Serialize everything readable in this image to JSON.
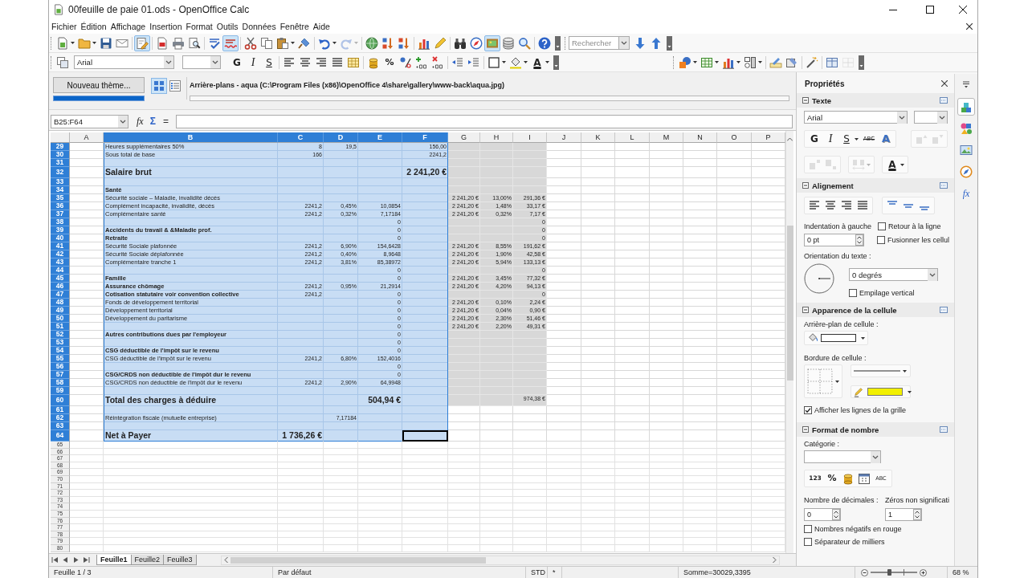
{
  "window": {
    "title": "00feuille de paie 01.ods - OpenOffice Calc"
  },
  "menu": [
    "Fichier",
    "Édition",
    "Affichage",
    "Insertion",
    "Format",
    "Outils",
    "Données",
    "Fenêtre",
    "Aide"
  ],
  "standard_toolbar": {
    "groups": [
      [
        {
          "kind": "document",
          "on": false,
          "disabled": false
        },
        {
          "kind": "caret",
          "on": false,
          "disabled": false
        },
        {
          "kind": "folder",
          "on": false,
          "disabled": false
        },
        {
          "kind": "caret",
          "on": false,
          "disabled": false
        },
        {
          "kind": "save",
          "on": false,
          "disabled": false
        },
        {
          "kind": "envelope",
          "on": false,
          "disabled": false
        }
      ],
      [
        {
          "kind": "edit",
          "on": true,
          "disabled": false
        }
      ],
      [
        {
          "kind": "pdf",
          "on": false,
          "disabled": false
        },
        {
          "kind": "printer",
          "on": false,
          "disabled": false
        },
        {
          "kind": "preview",
          "on": false,
          "disabled": false
        }
      ],
      [
        {
          "kind": "spellcheck",
          "on": false,
          "disabled": false
        },
        {
          "kind": "autospell",
          "on": true,
          "disabled": false
        }
      ],
      [
        {
          "kind": "scissors",
          "on": false,
          "disabled": false
        },
        {
          "kind": "copy",
          "on": false,
          "disabled": false
        },
        {
          "kind": "clipboard",
          "on": false,
          "disabled": false
        },
        {
          "kind": "caret",
          "on": false,
          "disabled": false
        },
        {
          "kind": "brush",
          "on": false,
          "disabled": false
        }
      ],
      [
        {
          "kind": "undo",
          "on": false,
          "disabled": false
        },
        {
          "kind": "caret",
          "on": false,
          "disabled": false
        },
        {
          "kind": "redo",
          "on": false,
          "disabled": true
        },
        {
          "kind": "caret",
          "on": false,
          "disabled": true
        }
      ],
      [
        {
          "kind": "globe",
          "on": false,
          "disabled": false
        },
        {
          "kind": "sort-asc",
          "on": false,
          "disabled": false
        },
        {
          "kind": "sort-desc",
          "on": false,
          "disabled": false
        }
      ],
      [
        {
          "kind": "chart",
          "on": false,
          "disabled": false
        },
        {
          "kind": "draw",
          "on": false,
          "disabled": false
        }
      ],
      [
        {
          "kind": "binoculars",
          "on": false,
          "disabled": false
        },
        {
          "kind": "compass",
          "on": false,
          "disabled": false
        },
        {
          "kind": "gallery",
          "on": true,
          "disabled": false
        },
        {
          "kind": "database",
          "on": false,
          "disabled": false
        },
        {
          "kind": "magnifier",
          "on": false,
          "disabled": false
        }
      ],
      [
        {
          "kind": "help",
          "on": false,
          "disabled": false
        }
      ]
    ]
  },
  "find_toolbar": {
    "placeholder": "Rechercher",
    "groups": [
      [
        {
          "kind": "arrow-down"
        },
        {
          "kind": "arrow-up"
        }
      ]
    ]
  },
  "formatting_toolbar": {
    "leading": [
      {
        "kind": "styles"
      }
    ],
    "font_name": "Arial",
    "groups": [
      [
        {
          "kind": "bold",
          "label": "G"
        },
        {
          "kind": "italic",
          "label": "I"
        },
        {
          "kind": "underline",
          "label": "S"
        }
      ],
      [
        {
          "kind": "align-left"
        },
        {
          "kind": "align-center"
        },
        {
          "kind": "align-right"
        },
        {
          "kind": "justify"
        },
        {
          "kind": "merge"
        }
      ],
      [
        {
          "kind": "coins"
        },
        {
          "kind": "percent",
          "label": "%"
        },
        {
          "kind": "number-format"
        },
        {
          "kind": "add-decimal"
        },
        {
          "kind": "del-decimal"
        }
      ],
      [
        {
          "kind": "indent-dec"
        },
        {
          "kind": "indent-inc"
        }
      ],
      [
        {
          "kind": "border"
        },
        {
          "kind": "caret"
        },
        {
          "kind": "bucket"
        },
        {
          "kind": "caret"
        },
        {
          "kind": "font-color",
          "label": "A"
        },
        {
          "kind": "caret"
        }
      ]
    ]
  },
  "drawing_toolbar": {
    "groups": [
      [
        {
          "kind": "shapes",
          "disabled": false
        },
        {
          "kind": "caret",
          "disabled": false
        },
        {
          "kind": "insert-table",
          "disabled": false
        },
        {
          "kind": "caret",
          "disabled": false
        },
        {
          "kind": "chart",
          "disabled": false
        },
        {
          "kind": "caret",
          "disabled": false
        },
        {
          "kind": "controls",
          "disabled": false
        },
        {
          "kind": "caret",
          "disabled": false
        }
      ],
      [
        {
          "kind": "design",
          "disabled": false
        },
        {
          "kind": "form-nav",
          "disabled": false
        }
      ],
      [
        {
          "kind": "wand",
          "disabled": false
        }
      ],
      [
        {
          "kind": "grid-view",
          "disabled": false
        },
        {
          "kind": "grid-dotted",
          "disabled": true
        }
      ]
    ]
  },
  "gallery": {
    "new_theme_button": "Nouveau thème...",
    "views": [
      {
        "kind": "icons",
        "selected": true
      },
      {
        "kind": "details",
        "selected": false
      }
    ],
    "path": "Arrière-plans - aqua (C:\\Program Files (x86)\\OpenOffice 4\\share\\gallery\\www-back\\aqua.jpg)"
  },
  "formula_bar": {
    "name_box": "B25:F64",
    "buttons": [
      "fx",
      "Σ",
      "="
    ]
  },
  "grid": {
    "columns": [
      {
        "label": "A",
        "selected": false,
        "cursor": false
      },
      {
        "label": "B",
        "selected": true,
        "cursor": false
      },
      {
        "label": "C",
        "selected": true,
        "cursor": false
      },
      {
        "label": "D",
        "selected": true,
        "cursor": false
      },
      {
        "label": "E",
        "selected": true,
        "cursor": false
      },
      {
        "label": "F",
        "selected": true,
        "cursor": true
      },
      {
        "label": "G",
        "selected": false,
        "cursor": false
      },
      {
        "label": "H",
        "selected": false,
        "cursor": false
      },
      {
        "label": "I",
        "selected": false,
        "cursor": false
      },
      {
        "label": "J",
        "selected": false,
        "cursor": false
      },
      {
        "label": "K",
        "selected": false,
        "cursor": false
      },
      {
        "label": "L",
        "selected": false,
        "cursor": false
      },
      {
        "label": "M",
        "selected": false,
        "cursor": false
      },
      {
        "label": "N",
        "selected": false,
        "cursor": false
      },
      {
        "label": "O",
        "selected": false,
        "cursor": false
      },
      {
        "label": "P",
        "selected": false,
        "cursor": false
      }
    ],
    "rows": [
      {
        "number": "29",
        "kind": "normal",
        "selected": true,
        "shaded": true,
        "cursor": false,
        "b": "Heures supplémentaires 50%",
        "c": "8",
        "d": "19,5",
        "f": "156,00"
      },
      {
        "number": "30",
        "kind": "normal",
        "selected": true,
        "shaded": true,
        "cursor": false,
        "b": "Sous total de base",
        "c": "166",
        "f": "2241,2"
      },
      {
        "number": "31",
        "kind": "normal",
        "selected": true,
        "shaded": true,
        "cursor": false
      },
      {
        "number": "32",
        "kind": "total",
        "selected": true,
        "shaded": true,
        "cursor": false,
        "b": "Salaire brut",
        "f": "2 241,20 €"
      },
      {
        "number": "33",
        "kind": "normal",
        "selected": true,
        "shaded": true,
        "cursor": false
      },
      {
        "number": "34",
        "kind": "section",
        "selected": true,
        "shaded": true,
        "cursor": false,
        "b": "Santé"
      },
      {
        "number": "35",
        "kind": "normal",
        "selected": true,
        "shaded": true,
        "cursor": false,
        "b": "Sécurité sociale – Maladie, invalidité décès",
        "g": "2 241,20 €",
        "h": "13,00%",
        "i": "291,36 €"
      },
      {
        "number": "36",
        "kind": "normal",
        "selected": true,
        "shaded": true,
        "cursor": false,
        "b": "Complément incapacité, invalidité, décès",
        "c": "2241,2",
        "d": "0,45%",
        "e": "10,0854",
        "g": "2 241,20 €",
        "h": "1,48%",
        "i": "33,17 €"
      },
      {
        "number": "37",
        "kind": "normal",
        "selected": true,
        "shaded": true,
        "cursor": false,
        "b": "Complémentaire santé",
        "c": "2241,2",
        "d": "0,32%",
        "e": "7,17184",
        "g": "2 241,20 €",
        "h": "0,32%",
        "i": "7,17 €"
      },
      {
        "number": "38",
        "kind": "normal",
        "selected": true,
        "shaded": true,
        "cursor": false,
        "e": "0",
        "i": "0"
      },
      {
        "number": "39",
        "kind": "section",
        "selected": true,
        "shaded": true,
        "cursor": false,
        "b": "Accidents du travail & &Maladie prof.",
        "e": "0",
        "i": "0"
      },
      {
        "number": "40",
        "kind": "section",
        "selected": true,
        "shaded": true,
        "cursor": false,
        "b": "Retraite",
        "e": "0",
        "i": "0"
      },
      {
        "number": "41",
        "kind": "normal",
        "selected": true,
        "shaded": true,
        "cursor": false,
        "b": "Sécurité Sociale plafonnée",
        "c": "2241,2",
        "d": "6,90%",
        "e": "154,6428",
        "g": "2 241,20 €",
        "h": "8,55%",
        "i": "191,62 €"
      },
      {
        "number": "42",
        "kind": "normal",
        "selected": true,
        "shaded": true,
        "cursor": false,
        "b": "Sécurité Sociale déplafonnée",
        "c": "2241,2",
        "d": "0,40%",
        "e": "8,9648",
        "g": "2 241,20 €",
        "h": "1,90%",
        "i": "42,58 €"
      },
      {
        "number": "43",
        "kind": "normal",
        "selected": true,
        "shaded": true,
        "cursor": false,
        "b": "Complémentaire tranche 1",
        "c": "2241,2",
        "d": "3,81%",
        "e": "85,38972",
        "g": "2 241,20 €",
        "h": "5,94%",
        "i": "133,13 €"
      },
      {
        "number": "44",
        "kind": "normal",
        "selected": true,
        "shaded": true,
        "cursor": false,
        "e": "0",
        "i": "0"
      },
      {
        "number": "45",
        "kind": "section",
        "selected": true,
        "shaded": true,
        "cursor": false,
        "b": "Famille",
        "e": "0",
        "g": "2 241,20 €",
        "h": "3,45%",
        "i": "77,32 €"
      },
      {
        "number": "46",
        "kind": "section",
        "selected": true,
        "shaded": true,
        "cursor": false,
        "b": "Assurance chômage",
        "c": "2241,2",
        "d": "0,95%",
        "e": "21,2914",
        "g": "2 241,20 €",
        "h": "4,20%",
        "i": "94,13 €"
      },
      {
        "number": "47",
        "kind": "section",
        "selected": true,
        "shaded": true,
        "cursor": false,
        "b": "Cotisation statutaire voir convention collective",
        "c": "2241,2",
        "e": "0",
        "i": "0"
      },
      {
        "number": "48",
        "kind": "normal",
        "selected": true,
        "shaded": true,
        "cursor": false,
        "b": "Fonds de développement territorial",
        "e": "0",
        "g": "2 241,20 €",
        "h": "0,10%",
        "i": "2,24 €"
      },
      {
        "number": "49",
        "kind": "normal",
        "selected": true,
        "shaded": true,
        "cursor": false,
        "b": "Développement territorial",
        "e": "0",
        "g": "2 241,20 €",
        "h": "0,04%",
        "i": "0,90 €"
      },
      {
        "number": "50",
        "kind": "normal",
        "selected": true,
        "shaded": true,
        "cursor": false,
        "b": "Développement du paritarisme",
        "e": "0",
        "g": "2 241,20 €",
        "h": "2,30%",
        "i": "51,46 €"
      },
      {
        "number": "51",
        "kind": "normal",
        "selected": true,
        "shaded": true,
        "cursor": false,
        "e": "0",
        "g": "2 241,20 €",
        "h": "2,20%",
        "i": "49,31 €"
      },
      {
        "number": "52",
        "kind": "section",
        "selected": true,
        "shaded": true,
        "cursor": false,
        "b": "Autres contributions dues par l'employeur",
        "e": "0"
      },
      {
        "number": "53",
        "kind": "normal",
        "selected": true,
        "shaded": true,
        "cursor": false,
        "e": "0"
      },
      {
        "number": "54",
        "kind": "section",
        "selected": true,
        "shaded": true,
        "cursor": false,
        "b": "CSG déductible de l'impôt sur le revenu",
        "e": "0"
      },
      {
        "number": "55",
        "kind": "normal",
        "selected": true,
        "shaded": true,
        "cursor": false,
        "b": "CSG déductible de l'impôt sur le revenu",
        "c": "2241,2",
        "d": "6,80%",
        "e": "152,4016"
      },
      {
        "number": "56",
        "kind": "normal",
        "selected": true,
        "shaded": true,
        "cursor": false,
        "e": "0"
      },
      {
        "number": "57",
        "kind": "section",
        "selected": true,
        "shaded": true,
        "cursor": false,
        "b": "CSG/CRDS non déductible de l'impôt dur le revenu",
        "e": "0"
      },
      {
        "number": "58",
        "kind": "normal",
        "selected": true,
        "shaded": true,
        "cursor": false,
        "b": "CSG/CRDS non déductible de l'impôt dur le revenu",
        "c": "2241,2",
        "d": "2,90%",
        "e": "64,9948"
      },
      {
        "number": "59",
        "kind": "normal",
        "selected": true,
        "shaded": true,
        "cursor": false
      },
      {
        "number": "60",
        "kind": "total",
        "selected": true,
        "shaded": true,
        "cursor": false,
        "b": "Total des charges à déduire",
        "e": "504,94 €",
        "i": "974,38 €"
      },
      {
        "number": "61",
        "kind": "normal",
        "selected": true,
        "shaded": false,
        "cursor": false
      },
      {
        "number": "62",
        "kind": "normal",
        "selected": true,
        "shaded": false,
        "cursor": false,
        "b": "Réintégration fiscale (mutuelle entreprise)",
        "d": "7,17184"
      },
      {
        "number": "63",
        "kind": "normal",
        "selected": true,
        "shaded": false,
        "cursor": false
      },
      {
        "number": "64",
        "kind": "total",
        "selected": true,
        "shaded": false,
        "cursor": true,
        "b": "Net à Payer",
        "c": "1 736,26 €"
      },
      {
        "number": "65",
        "kind": "short",
        "selected": false,
        "shaded": false,
        "cursor": false
      },
      {
        "number": "66",
        "kind": "short",
        "selected": false,
        "shaded": false,
        "cursor": false
      },
      {
        "number": "67",
        "kind": "short",
        "selected": false,
        "shaded": false,
        "cursor": false
      },
      {
        "number": "68",
        "kind": "short",
        "selected": false,
        "shaded": false,
        "cursor": false
      },
      {
        "number": "69",
        "kind": "short",
        "selected": false,
        "shaded": false,
        "cursor": false
      },
      {
        "number": "70",
        "kind": "short",
        "selected": false,
        "shaded": false,
        "cursor": false
      },
      {
        "number": "71",
        "kind": "short",
        "selected": false,
        "shaded": false,
        "cursor": false
      },
      {
        "number": "72",
        "kind": "short",
        "selected": false,
        "shaded": false,
        "cursor": false
      },
      {
        "number": "73",
        "kind": "short",
        "selected": false,
        "shaded": false,
        "cursor": false
      },
      {
        "number": "74",
        "kind": "short",
        "selected": false,
        "shaded": false,
        "cursor": false
      },
      {
        "number": "75",
        "kind": "short",
        "selected": false,
        "shaded": false,
        "cursor": false
      },
      {
        "number": "76",
        "kind": "short",
        "selected": false,
        "shaded": false,
        "cursor": false
      },
      {
        "number": "77",
        "kind": "short",
        "selected": false,
        "shaded": false,
        "cursor": false
      },
      {
        "number": "78",
        "kind": "short",
        "selected": false,
        "shaded": false,
        "cursor": false
      },
      {
        "number": "79",
        "kind": "short",
        "selected": false,
        "shaded": false,
        "cursor": false
      },
      {
        "number": "80",
        "kind": "short",
        "selected": false,
        "shaded": false,
        "cursor": false
      }
    ]
  },
  "sheet_tabs": [
    {
      "label": "Feuille1",
      "selected": true
    },
    {
      "label": "Feuille2",
      "selected": false
    },
    {
      "label": "Feuille3",
      "selected": false
    }
  ],
  "sidebar": {
    "title": "Propriétés",
    "text": {
      "title": "Texte",
      "font_name": "Arial",
      "rows": [
        {
          "groups": [
            [
              {
                "kind": "bold",
                "label": "G",
                "disabled": false
              },
              {
                "kind": "italic",
                "label": "I",
                "disabled": false
              },
              {
                "kind": "underline",
                "label": "S",
                "disabled": false
              },
              {
                "kind": "caret",
                "disabled": false
              },
              {
                "kind": "strike",
                "label": "ABC",
                "disabled": false
              },
              {
                "kind": "shadow",
                "label": "A",
                "disabled": false
              }
            ],
            [
              {
                "kind": "grow",
                "disabled": true
              },
              {
                "kind": "shrink",
                "disabled": true
              }
            ]
          ]
        },
        {
          "groups": [
            [
              {
                "kind": "superscript",
                "disabled": true
              },
              {
                "kind": "subscript",
                "disabled": true
              }
            ],
            [
              {
                "kind": "spacing",
                "disabled": true
              },
              {
                "kind": "caret",
                "disabled": true
              }
            ],
            [
              {
                "kind": "font-color",
                "label": "A",
                "disabled": false
              },
              {
                "kind": "caret",
                "disabled": false
              }
            ]
          ]
        }
      ]
    },
    "alignment": {
      "title": "Alignement",
      "groups": [
        [
          {
            "kind": "align-left"
          },
          {
            "kind": "align-center"
          },
          {
            "kind": "align-right"
          },
          {
            "kind": "justify"
          }
        ],
        [
          {
            "kind": "valign-top"
          },
          {
            "kind": "valign-middle"
          },
          {
            "kind": "valign-bottom"
          }
        ]
      ],
      "indent_label": "Indentation à gauche",
      "indent_value": "0 pt",
      "wrap": {
        "label": "Retour à la ligne",
        "checked": false
      },
      "merge": {
        "label": "Fusionner les cellul",
        "checked": false
      },
      "orientation_label": "Orientation du texte :",
      "orientation_value": "0 degrés",
      "stacked": {
        "label": "Empilage vertical",
        "checked": false
      }
    },
    "cell_appearance": {
      "title": "Apparence de la cellule",
      "background_label": "Arrière-plan de cellule :",
      "border_label": "Bordure de cellule :",
      "gridlines": {
        "label": "Afficher les lignes de la grille",
        "checked": true
      }
    },
    "number_format": {
      "title": "Format de nombre",
      "category_label": "Catégorie :",
      "buttons": [
        {
          "kind": "num",
          "label": "123"
        },
        {
          "kind": "percent",
          "label": "%"
        },
        {
          "kind": "coins"
        },
        {
          "kind": "calendar"
        },
        {
          "kind": "abc",
          "label": "ABC"
        }
      ],
      "decimals_label": "Nombre de décimales :",
      "decimals": "0",
      "leading_zeros_label": "Zéros non significati",
      "leading_zeros": "1",
      "negative_red": {
        "label": "Nombres négatifs en rouge",
        "checked": false
      },
      "thousands": {
        "label": "Séparateur de milliers",
        "checked": false
      }
    },
    "tabs": [
      {
        "kind": "properties",
        "selected": true
      },
      {
        "kind": "styles",
        "selected": false
      },
      {
        "kind": "gallery",
        "selected": false
      },
      {
        "kind": "navigator",
        "selected": false
      },
      {
        "kind": "functions",
        "label": "fx",
        "selected": false
      }
    ]
  },
  "status_bar": {
    "sheet": "Feuille 1 / 3",
    "page_style": "Par défaut",
    "mode": "STD",
    "modified": "*",
    "sum": "Somme=30029,3395",
    "zoom": {
      "level": 0.4,
      "reading": "68 %"
    }
  }
}
